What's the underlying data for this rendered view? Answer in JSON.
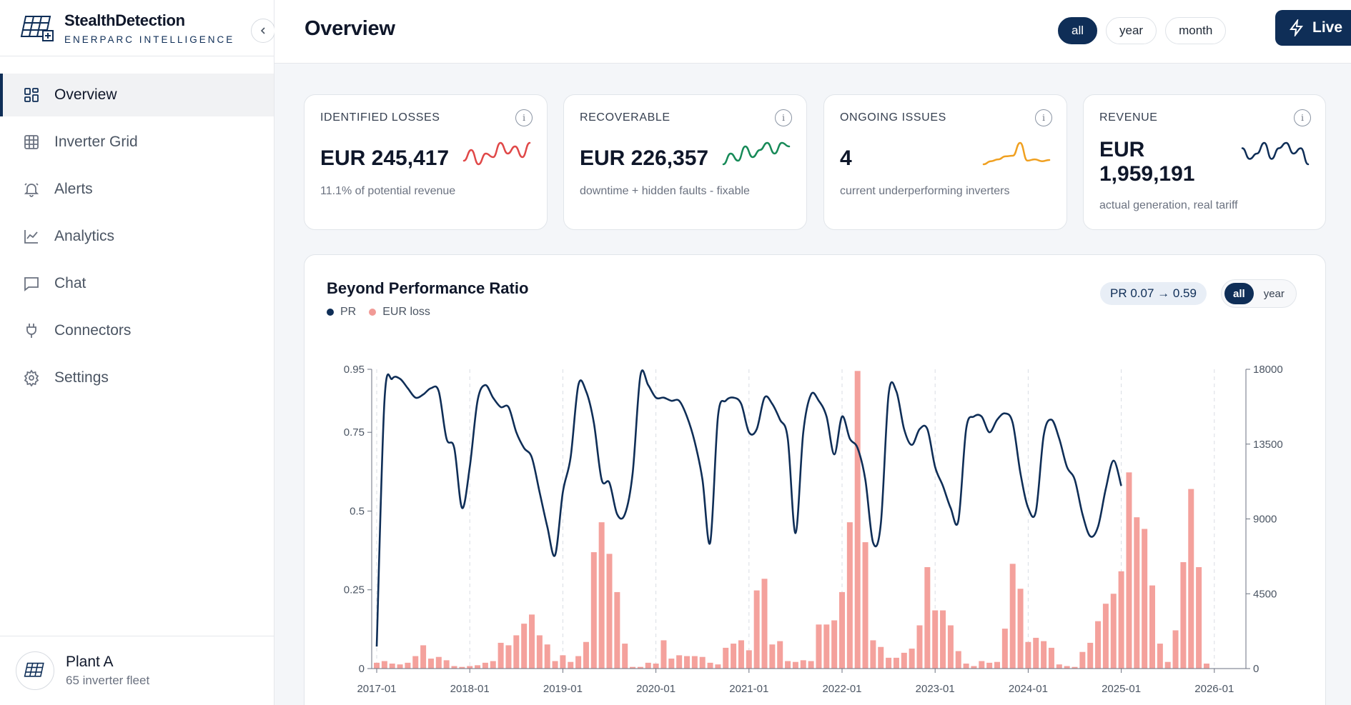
{
  "brand": {
    "name": "StealthDetection",
    "subtitle": "ENERPARC INTELLIGENCE"
  },
  "sidebar": {
    "items": [
      {
        "label": "Overview",
        "icon": "grid-icon",
        "active": true
      },
      {
        "label": "Inverter Grid",
        "icon": "table-icon"
      },
      {
        "label": "Alerts",
        "icon": "bell-icon"
      },
      {
        "label": "Analytics",
        "icon": "chart-line-icon"
      },
      {
        "label": "Chat",
        "icon": "chat-icon"
      },
      {
        "label": "Connectors",
        "icon": "plug-icon"
      },
      {
        "label": "Settings",
        "icon": "gear-icon"
      }
    ],
    "plant": {
      "name": "Plant A",
      "subtitle": "65 inverter fleet"
    }
  },
  "header": {
    "title": "Overview",
    "ranges": [
      "all",
      "year",
      "month"
    ],
    "active_range": "all",
    "live_label": "Live"
  },
  "kpis": [
    {
      "label": "IDENTIFIED LOSSES",
      "value": "EUR 245,417",
      "sub": "11.1% of potential revenue",
      "color": "#e04848",
      "spark": [
        4,
        7,
        3,
        6,
        5,
        9,
        6,
        8,
        5,
        9
      ]
    },
    {
      "label": "RECOVERABLE",
      "value": "EUR 226,357",
      "sub": "downtime + hidden faults - fixable",
      "color": "#178a58",
      "spark": [
        3,
        6,
        4,
        8,
        5,
        7,
        9,
        6,
        9,
        8
      ]
    },
    {
      "label": "ONGOING ISSUES",
      "value": "4",
      "sub": "current underperforming inverters",
      "color": "#f0a020",
      "spark": [
        4,
        4.5,
        4.8,
        5.3,
        5.4,
        7.5,
        4.6,
        4.8,
        4.5,
        4.7
      ]
    },
    {
      "label": "REVENUE",
      "value": "EUR 1,959,191",
      "sub": "actual generation, real tariff",
      "color": "#0f2e57",
      "spark": [
        6,
        4,
        5,
        7,
        4,
        6,
        7,
        5,
        6,
        3
      ]
    }
  ],
  "chart": {
    "title": "Beyond Performance Ratio",
    "legend": [
      {
        "name": "PR",
        "color": "#0f2e57"
      },
      {
        "name": "EUR loss",
        "color": "#f19a96"
      }
    ],
    "pr_badge": "PR 0.07 → 0.59",
    "toggle": [
      "all",
      "year"
    ],
    "toggle_active": "all"
  },
  "chart_data": {
    "type": "bar+line",
    "left_axis": {
      "ticks": [
        "0",
        "0.25",
        "0.5",
        "0.75",
        "0.95"
      ],
      "range": [
        0,
        0.95
      ]
    },
    "right_axis": {
      "ticks": [
        "0",
        "4500",
        "9000",
        "13500",
        "18000"
      ],
      "range": [
        0,
        18000
      ]
    },
    "x_ticks": [
      "2017-01",
      "2018-01",
      "2019-01",
      "2020-01",
      "2021-01",
      "2022-01",
      "2023-01",
      "2024-01",
      "2025-01",
      "2026-01"
    ],
    "pr": [
      0.07,
      0.85,
      0.92,
      0.92,
      0.89,
      0.86,
      0.87,
      0.89,
      0.88,
      0.73,
      0.7,
      0.51,
      0.64,
      0.85,
      0.9,
      0.86,
      0.83,
      0.83,
      0.75,
      0.7,
      0.67,
      0.56,
      0.45,
      0.36,
      0.56,
      0.67,
      0.9,
      0.88,
      0.78,
      0.6,
      0.59,
      0.49,
      0.49,
      0.62,
      0.93,
      0.9,
      0.86,
      0.86,
      0.85,
      0.85,
      0.8,
      0.72,
      0.6,
      0.4,
      0.8,
      0.85,
      0.86,
      0.84,
      0.75,
      0.76,
      0.86,
      0.84,
      0.79,
      0.73,
      0.43,
      0.75,
      0.87,
      0.85,
      0.8,
      0.68,
      0.8,
      0.73,
      0.7,
      0.6,
      0.4,
      0.46,
      0.87,
      0.88,
      0.76,
      0.71,
      0.76,
      0.76,
      0.64,
      0.58,
      0.51,
      0.47,
      0.76,
      0.8,
      0.8,
      0.75,
      0.79,
      0.81,
      0.78,
      0.62,
      0.51,
      0.5,
      0.74,
      0.79,
      0.73,
      0.64,
      0.6,
      0.49,
      0.42,
      0.45,
      0.57,
      0.66,
      0.58
    ],
    "eur_loss": [
      350,
      450,
      300,
      250,
      350,
      750,
      1400,
      600,
      700,
      500,
      150,
      100,
      150,
      200,
      350,
      450,
      1550,
      1400,
      2000,
      2700,
      3250,
      2000,
      1450,
      450,
      800,
      400,
      750,
      1600,
      7000,
      8800,
      6900,
      4600,
      1500,
      100,
      100,
      350,
      300,
      1700,
      600,
      800,
      750,
      750,
      700,
      350,
      250,
      1250,
      1500,
      1700,
      1100,
      4700,
      5400,
      1450,
      1650,
      450,
      400,
      500,
      450,
      2650,
      2650,
      2900,
      4600,
      8800,
      17900,
      7600,
      1700,
      1300,
      650,
      650,
      950,
      1200,
      2600,
      6100,
      3500,
      3500,
      2600,
      1050,
      300,
      150,
      450,
      350,
      400,
      2400,
      6300,
      4800,
      1600,
      1850,
      1650,
      1250,
      250,
      150,
      100,
      1000,
      1550,
      2850,
      3900,
      4500,
      5850,
      11800,
      9100,
      8400,
      5000,
      1500,
      400,
      2300,
      6400,
      10800,
      6100,
      300
    ]
  }
}
